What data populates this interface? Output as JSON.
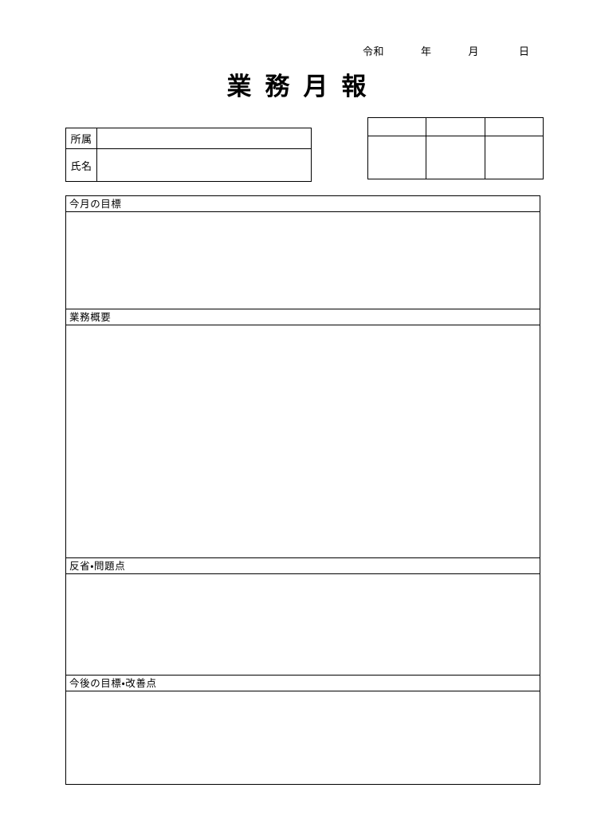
{
  "document": {
    "title": "業　務　月　報",
    "title_plain": "業務月報"
  },
  "date_line": {
    "era": "令和",
    "year_label": "年",
    "month_label": "月",
    "day_label": "日"
  },
  "person_table": {
    "rows": [
      {
        "label": "所属",
        "value": ""
      },
      {
        "label": "氏名",
        "value": ""
      }
    ]
  },
  "stamp_table": {
    "head_cells": [
      "",
      "",
      ""
    ],
    "body_cells": [
      "",
      "",
      ""
    ]
  },
  "sections": [
    {
      "header": "今月の目標",
      "body": ""
    },
    {
      "header": "業務概要",
      "body": ""
    },
    {
      "header": "反省・問題点",
      "body": ""
    },
    {
      "header": "今後の目標・改善点",
      "body": ""
    }
  ]
}
